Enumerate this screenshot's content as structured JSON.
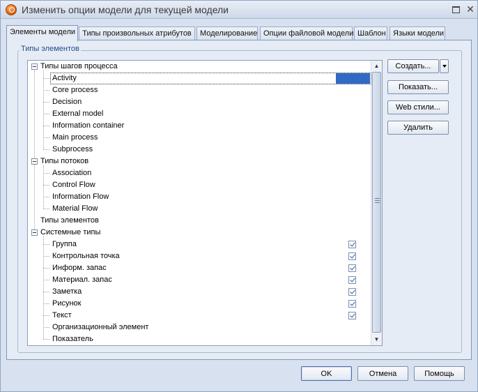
{
  "window": {
    "title": "Изменить опции модели для текущей модели"
  },
  "tabs": [
    {
      "label": "Элементы модели",
      "active": true
    },
    {
      "label": "Типы произвольных атрибутов",
      "active": false
    },
    {
      "label": "Моделирование",
      "active": false
    },
    {
      "label": "Опции файловой модели",
      "active": false
    },
    {
      "label": "Шаблон",
      "active": false
    },
    {
      "label": "Языки модели",
      "active": false
    }
  ],
  "group": {
    "label": "Типы элементов"
  },
  "tree": {
    "rows": [
      {
        "label": "Типы шагов процесса",
        "level": 0,
        "expander": true,
        "checked": false
      },
      {
        "label": "Activity",
        "level": 1,
        "expander": false,
        "checked": false,
        "selected": true
      },
      {
        "label": "Core process",
        "level": 1,
        "expander": false,
        "checked": false
      },
      {
        "label": "Decision",
        "level": 1,
        "expander": false,
        "checked": false
      },
      {
        "label": "External model",
        "level": 1,
        "expander": false,
        "checked": false
      },
      {
        "label": "Information container",
        "level": 1,
        "expander": false,
        "checked": false
      },
      {
        "label": "Main process",
        "level": 1,
        "expander": false,
        "checked": false
      },
      {
        "label": "Subprocess",
        "level": 1,
        "expander": false,
        "checked": false
      },
      {
        "label": "Типы потоков",
        "level": 0,
        "expander": true,
        "checked": false
      },
      {
        "label": "Association",
        "level": 1,
        "expander": false,
        "checked": false
      },
      {
        "label": "Control Flow",
        "level": 1,
        "expander": false,
        "checked": false
      },
      {
        "label": "Information Flow",
        "level": 1,
        "expander": false,
        "checked": false
      },
      {
        "label": "Material Flow",
        "level": 1,
        "expander": false,
        "checked": false
      },
      {
        "label": "Типы элементов",
        "level": 0,
        "expander": false,
        "checked": false
      },
      {
        "label": "Системные типы",
        "level": 0,
        "expander": true,
        "checked": false
      },
      {
        "label": "Группа",
        "level": 1,
        "expander": false,
        "checked": true
      },
      {
        "label": "Контрольная точка",
        "level": 1,
        "expander": false,
        "checked": true
      },
      {
        "label": "Информ. запас",
        "level": 1,
        "expander": false,
        "checked": true
      },
      {
        "label": "Материал. запас",
        "level": 1,
        "expander": false,
        "checked": true
      },
      {
        "label": "Заметка",
        "level": 1,
        "expander": false,
        "checked": true
      },
      {
        "label": "Рисунок",
        "level": 1,
        "expander": false,
        "checked": true
      },
      {
        "label": "Текст",
        "level": 1,
        "expander": false,
        "checked": true
      },
      {
        "label": "Организационный элемент",
        "level": 1,
        "expander": false,
        "checked": false
      },
      {
        "label": "Показатель",
        "level": 1,
        "expander": false,
        "checked": false
      }
    ]
  },
  "side_buttons": {
    "create": "Создать...",
    "show": "Показать...",
    "web_styles": "Web стили...",
    "delete": "Удалить"
  },
  "footer_buttons": {
    "ok": "OK",
    "cancel": "Отмена",
    "help": "Помощь"
  },
  "colors": {
    "selection": "#316ac5",
    "group_label": "#1f4d87"
  }
}
